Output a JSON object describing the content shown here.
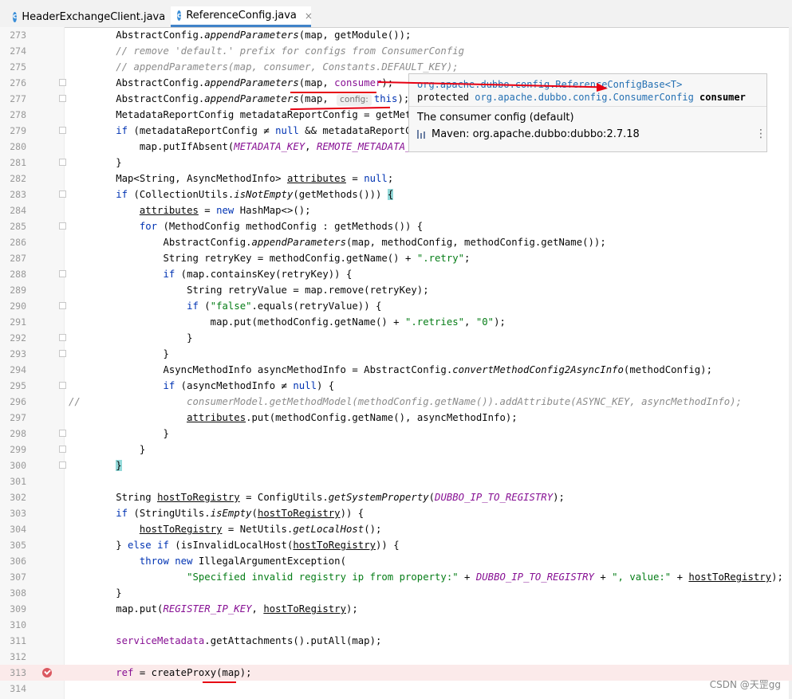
{
  "tabs": [
    {
      "label": "HeaderExchangeClient.java",
      "close": "×",
      "active": false
    },
    {
      "label": "ReferenceConfig.java",
      "close": "×",
      "active": true
    }
  ],
  "tab_icon_letter": "c",
  "popup": {
    "link": "org.apache.dubbo.config.ReferenceConfigBase<T>",
    "signature_prefix": "protected",
    "signature_type": "org.apache.dubbo.config.ConsumerConfig",
    "signature_name": "consumer",
    "description": "The consumer config (default)",
    "maven": "Maven: org.apache.dubbo:dubbo:2.7.18",
    "more": "⋮"
  },
  "inlay_hint": "config:",
  "watermark": "CSDN @天罡gg",
  "colors": {
    "keyword": "#0033b3",
    "string": "#067d17",
    "comment": "#8c8c8c",
    "constant": "#871094",
    "annotation_red": "#e60012",
    "breakpoint": "#db5860"
  },
  "lines": [
    {
      "n": "273",
      "code": "        AbstractConfig.appendParameters(map, getModule());"
    },
    {
      "n": "274",
      "code": "        // remove 'default.' prefix for configs from ConsumerConfig"
    },
    {
      "n": "275",
      "code": "        // appendParameters(map, consumer, Constants.DEFAULT_KEY);"
    },
    {
      "n": "276",
      "code": "        AbstractConfig.appendParameters(map, consumer);"
    },
    {
      "n": "277",
      "code": "        AbstractConfig.appendParameters(map, config: this);"
    },
    {
      "n": "278",
      "code": "        MetadataReportConfig metadataReportConfig = getMetada"
    },
    {
      "n": "279",
      "code": "        if (metadataReportConfig ≠ null && metadataReportCon"
    },
    {
      "n": "280",
      "code": "            map.putIfAbsent(METADATA_KEY, REMOTE_METADATA_STO"
    },
    {
      "n": "281",
      "code": "        }"
    },
    {
      "n": "282",
      "code": "        Map<String, AsyncMethodInfo> attributes = null;"
    },
    {
      "n": "283",
      "code": "        if (CollectionUtils.isNotEmpty(getMethods())) {"
    },
    {
      "n": "284",
      "code": "            attributes = new HashMap<>();"
    },
    {
      "n": "285",
      "code": "            for (MethodConfig methodConfig : getMethods()) {"
    },
    {
      "n": "286",
      "code": "                AbstractConfig.appendParameters(map, methodConfig, methodConfig.getName());"
    },
    {
      "n": "287",
      "code": "                String retryKey = methodConfig.getName() + \".retry\";"
    },
    {
      "n": "288",
      "code": "                if (map.containsKey(retryKey)) {"
    },
    {
      "n": "289",
      "code": "                    String retryValue = map.remove(retryKey);"
    },
    {
      "n": "290",
      "code": "                    if (\"false\".equals(retryValue)) {"
    },
    {
      "n": "291",
      "code": "                        map.put(methodConfig.getName() + \".retries\", \"0\");"
    },
    {
      "n": "292",
      "code": "                    }"
    },
    {
      "n": "293",
      "code": "                }"
    },
    {
      "n": "294",
      "code": "                AsyncMethodInfo asyncMethodInfo = AbstractConfig.convertMethodConfig2AsyncInfo(methodConfig);"
    },
    {
      "n": "295",
      "code": "                if (asyncMethodInfo ≠ null) {"
    },
    {
      "n": "296",
      "code": "//                  consumerModel.getMethodModel(methodConfig.getName()).addAttribute(ASYNC_KEY, asyncMethodInfo);"
    },
    {
      "n": "297",
      "code": "                    attributes.put(methodConfig.getName(), asyncMethodInfo);"
    },
    {
      "n": "298",
      "code": "                }"
    },
    {
      "n": "299",
      "code": "            }"
    },
    {
      "n": "300",
      "code": "        }"
    },
    {
      "n": "301",
      "code": ""
    },
    {
      "n": "302",
      "code": "        String hostToRegistry = ConfigUtils.getSystemProperty(DUBBO_IP_TO_REGISTRY);"
    },
    {
      "n": "303",
      "code": "        if (StringUtils.isEmpty(hostToRegistry)) {"
    },
    {
      "n": "304",
      "code": "            hostToRegistry = NetUtils.getLocalHost();"
    },
    {
      "n": "305",
      "code": "        } else if (isInvalidLocalHost(hostToRegistry)) {"
    },
    {
      "n": "306",
      "code": "            throw new IllegalArgumentException("
    },
    {
      "n": "307",
      "code": "                    \"Specified invalid registry ip from property:\" + DUBBO_IP_TO_REGISTRY + \", value:\" + hostToRegistry);"
    },
    {
      "n": "308",
      "code": "        }"
    },
    {
      "n": "309",
      "code": "        map.put(REGISTER_IP_KEY, hostToRegistry);"
    },
    {
      "n": "310",
      "code": ""
    },
    {
      "n": "311",
      "code": "        serviceMetadata.getAttachments().putAll(map);"
    },
    {
      "n": "312",
      "code": ""
    },
    {
      "n": "313",
      "code": "        ref = createProxy(map);"
    },
    {
      "n": "314",
      "code": ""
    }
  ]
}
